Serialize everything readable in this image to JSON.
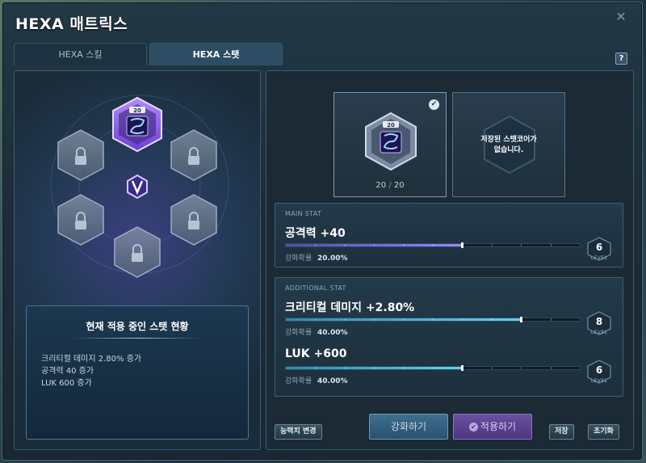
{
  "window": {
    "title": "HEXA 매트릭스",
    "close_glyph": "✕",
    "help_glyph": "?"
  },
  "tabs": [
    {
      "label": "HEXA 스킬",
      "active": false
    },
    {
      "label": "HEXA 스탯",
      "active": true
    }
  ],
  "hex_matrix": {
    "center_icon": "hexa-v-emblem-icon",
    "slots": [
      {
        "name": "active-core-slot",
        "icon": "hexa-stat-core-icon",
        "badge": "20",
        "locked": false
      },
      {
        "name": "locked-slot-top-left",
        "icon": "lock-icon",
        "locked": true
      },
      {
        "name": "locked-slot-top-right",
        "icon": "lock-icon",
        "locked": true
      },
      {
        "name": "locked-slot-bottom-left",
        "icon": "lock-icon",
        "locked": true
      },
      {
        "name": "locked-slot-bottom-right",
        "icon": "lock-icon",
        "locked": true
      },
      {
        "name": "locked-slot-bottom",
        "icon": "lock-icon",
        "locked": true
      }
    ]
  },
  "status_box": {
    "title": "현재 적용 중인 스탯 현황",
    "lines": [
      "크리티컬 데미지 2.80% 증가",
      "공격력 40 증가",
      "LUK 600 증가"
    ]
  },
  "core_cards": {
    "selected": {
      "badge": "20",
      "count": "20",
      "separator": "/",
      "max": "20",
      "checked": true
    },
    "empty": {
      "message_line1": "저장된 스탯코어가",
      "message_line2": "없습니다."
    }
  },
  "main_stat": {
    "section_label": "MAIN STAT",
    "name": "공격력 +40",
    "progress": 0.6,
    "rate_label": "강화확률",
    "rate_value": "20.00%",
    "level": "6",
    "level_label": "LEVEL",
    "bar_color": "#8a74f0"
  },
  "additional_stat": {
    "section_label": "ADDITIONAL STAT",
    "stats": [
      {
        "name": "크리티컬 데미지 +2.80%",
        "progress": 0.8,
        "rate_label": "강화확률",
        "rate_value": "40.00%",
        "level": "8",
        "level_label": "LEVEL"
      },
      {
        "name": "LUK +600",
        "progress": 0.6,
        "rate_label": "강화확률",
        "rate_value": "40.00%",
        "level": "6",
        "level_label": "LEVEL"
      }
    ],
    "bar_color": "#4cc3e6"
  },
  "buttons": {
    "change_stat": "능력치 변경",
    "enhance": "강화하기",
    "apply": "적용하기",
    "save": "저장",
    "reset": "초기화"
  }
}
